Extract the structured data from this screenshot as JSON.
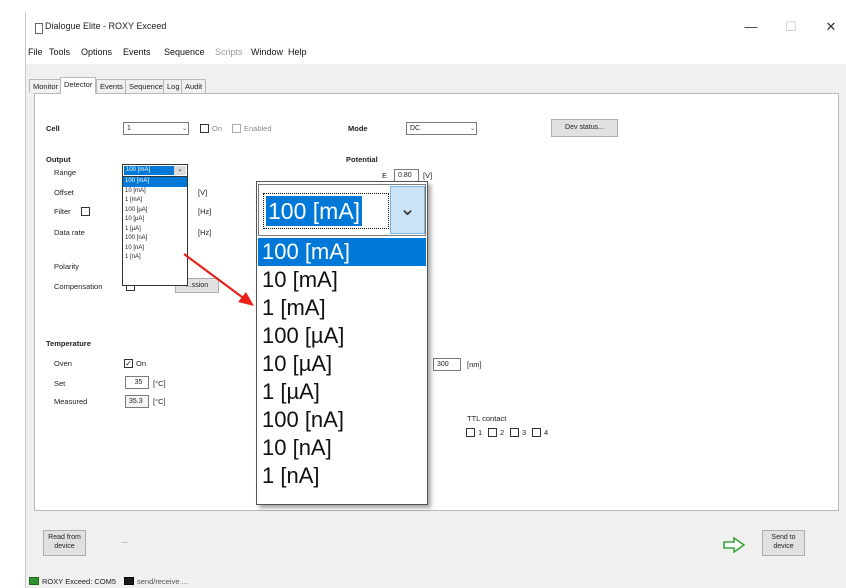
{
  "window": {
    "title": "Dialogue Elite - ROXY Exceed",
    "minimize": "—",
    "maximize": "☐",
    "close": "✕"
  },
  "menu": [
    {
      "label": "File",
      "disabled": false
    },
    {
      "label": "Tools",
      "disabled": false
    },
    {
      "label": "Options",
      "disabled": false
    },
    {
      "label": "Events",
      "disabled": false
    },
    {
      "label": "Sequence",
      "disabled": false
    },
    {
      "label": "Scripts",
      "disabled": true
    },
    {
      "label": "Window",
      "disabled": false
    },
    {
      "label": "Help",
      "disabled": false
    }
  ],
  "tabs": [
    "Monitor",
    "Detector",
    "Events",
    "Sequence",
    "Log",
    "Audit"
  ],
  "active_tab": "Detector",
  "cell": {
    "label": "Cell",
    "value": "1",
    "on_label": "On",
    "enabled_label": "Enabled",
    "mode_label": "Mode",
    "mode_value": "DC",
    "dev_status_button": "Dev status..."
  },
  "output": {
    "heading": "Output",
    "range_label": "Range",
    "range_value": "100 [mA]",
    "offset_label": "Offset",
    "offset_unit": "[V]",
    "filter_label": "Filter",
    "filter_unit": "[Hz]",
    "data_rate_label": "Data rate",
    "data_rate_unit": "[Hz]",
    "polarity_label": "Polarity",
    "compensation_label": "Compensation",
    "compensation_button": "...ssion"
  },
  "range_options": [
    "100 [mA]",
    "10 [mA]",
    "1 [mA]",
    "100 [µA]",
    "10 [µA]",
    "1 [µA]",
    "100 [nA]",
    "10 [nA]",
    "1 [nA]"
  ],
  "potential": {
    "heading": "Potential",
    "e_label": "E",
    "e_value": "0.80",
    "e_unit": "[V]"
  },
  "temperature": {
    "heading": "Temperature",
    "oven_label": "Oven",
    "oven_checkbox": "On",
    "set_label": "Set",
    "set_value": "35",
    "set_unit": "[°C]",
    "measured_label": "Measured",
    "measured_value": "35.3",
    "measured_unit": "[°C]"
  },
  "wavelength": {
    "value": "300",
    "unit": "[nm]"
  },
  "ttl": {
    "label": "TTL contact",
    "contacts": [
      "1",
      "2",
      "3",
      "4"
    ]
  },
  "bottom": {
    "read_button": "Read from device",
    "dash": "—",
    "send_button": "Send to device"
  },
  "status": {
    "left": "ROXY Exceed: COM5",
    "right": "send/receive ..."
  },
  "colors": {
    "selection": "#0078d7",
    "arrow": "#e8221b",
    "send_arrow": "#3aa63a"
  }
}
